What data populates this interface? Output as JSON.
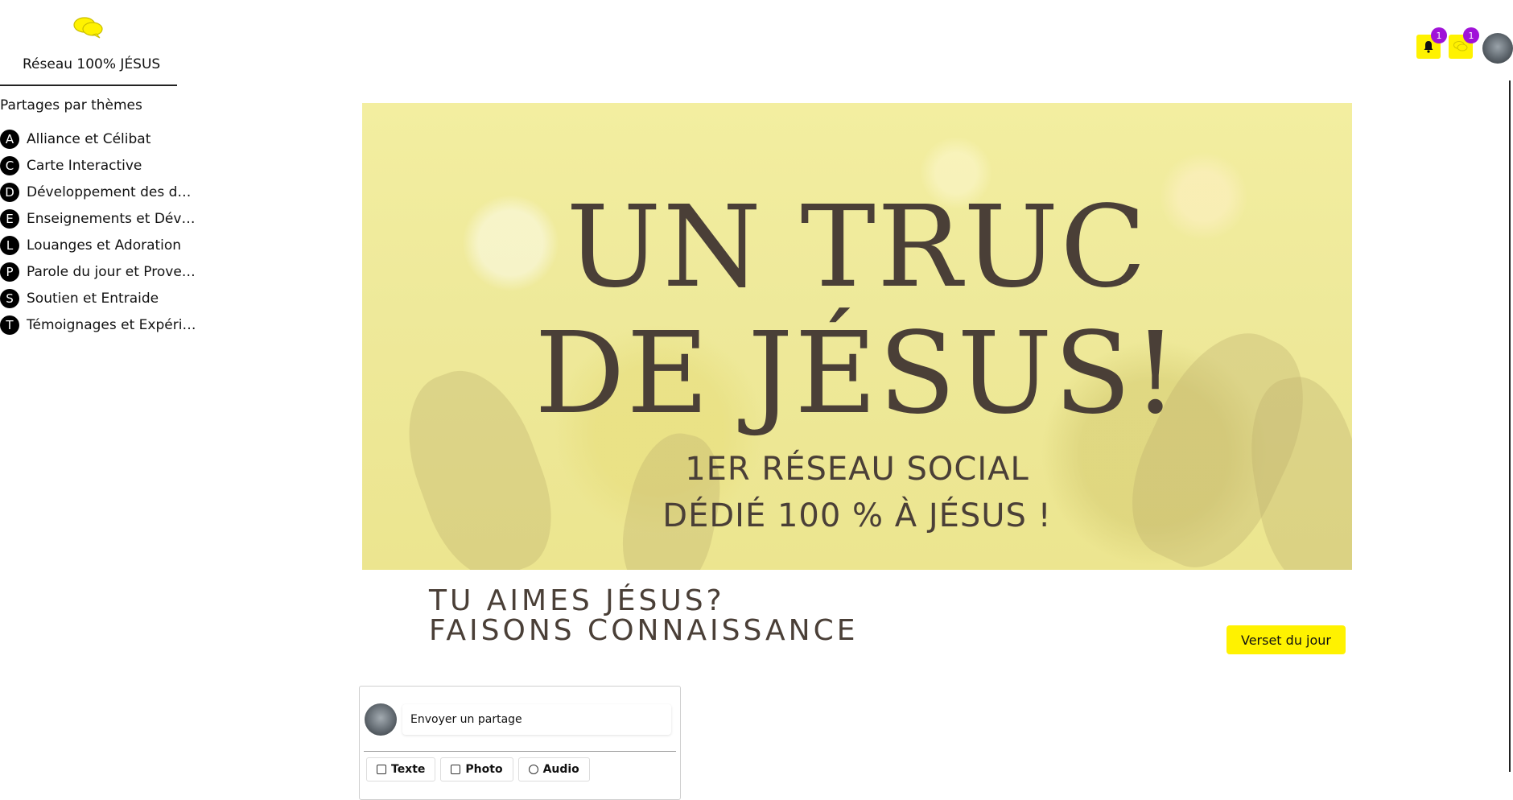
{
  "app": {
    "title": "Réseau 100% JÉSUS",
    "logo_icon": "speech-bubbles-icon"
  },
  "sidebar": {
    "section_title": "Partages par thèmes",
    "themes": [
      {
        "letter": "A",
        "label": "Alliance et Célibat"
      },
      {
        "letter": "C",
        "label": "Carte Interactive"
      },
      {
        "letter": "D",
        "label": "Développement des do..."
      },
      {
        "letter": "E",
        "label": "Enseignements et Dévoi..."
      },
      {
        "letter": "L",
        "label": "Louanges et Adoration"
      },
      {
        "letter": "P",
        "label": "Parole du jour et Prover..."
      },
      {
        "letter": "S",
        "label": "Soutien et Entraide"
      },
      {
        "letter": "T",
        "label": "Témoignages et Expérie..."
      }
    ]
  },
  "topbar": {
    "notifications_badge": "1",
    "messages_badge": "1",
    "accent_color": "#fff200",
    "badge_color": "#a012d8"
  },
  "banner": {
    "headline_line1": "UN TRUC",
    "headline_line2": "DE JÉSUS!",
    "subline1": "1ER RÉSEAU SOCIAL",
    "subline2": "DÉDIÉ 100 % À JÉSUS !"
  },
  "tagline": {
    "line1": "TU AIMES JÉSUS?",
    "line2": "FAISONS CONNAISSANCE"
  },
  "verse_button": "Verset du jour",
  "composer": {
    "placeholder": "Envoyer un partage",
    "tabs": [
      "Texte",
      "Photo",
      "Audio"
    ]
  }
}
